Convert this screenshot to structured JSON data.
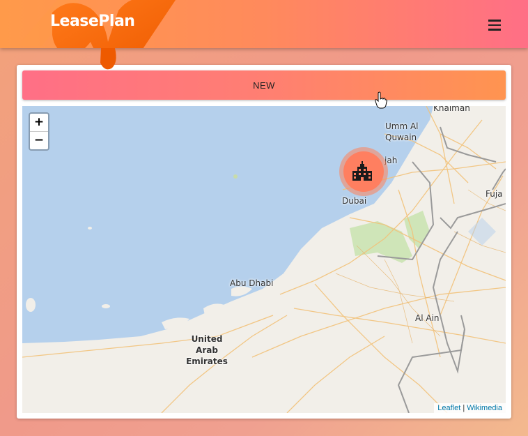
{
  "header": {
    "logo_text": "LeasePlan",
    "menu_icon": "hamburger-menu-icon"
  },
  "toolbar": {
    "new_label": "NEW"
  },
  "map": {
    "zoom_in": "+",
    "zoom_out": "−",
    "places": {
      "khaiman": "Khaiman",
      "umm_al_quwain": "Umm Al\nQuwain",
      "jah": "jah",
      "dubai": "Dubai",
      "fuja": "Fuja",
      "abu_dhabi": "Abu Dhabi",
      "al_ain": "Al Ain",
      "uae": "United\nArab\nEmirates"
    },
    "marker_icon": "building-icon",
    "attribution": {
      "leaflet": "Leaflet",
      "separator": " | ",
      "wikimedia": "Wikimedia"
    }
  },
  "colors": {
    "header_start": "#ff9a4a",
    "header_end": "#ff6f86",
    "marker": "#ff7f60",
    "water": "#b5d0ec",
    "land": "#f2efe9",
    "road": "#f2c27a"
  }
}
